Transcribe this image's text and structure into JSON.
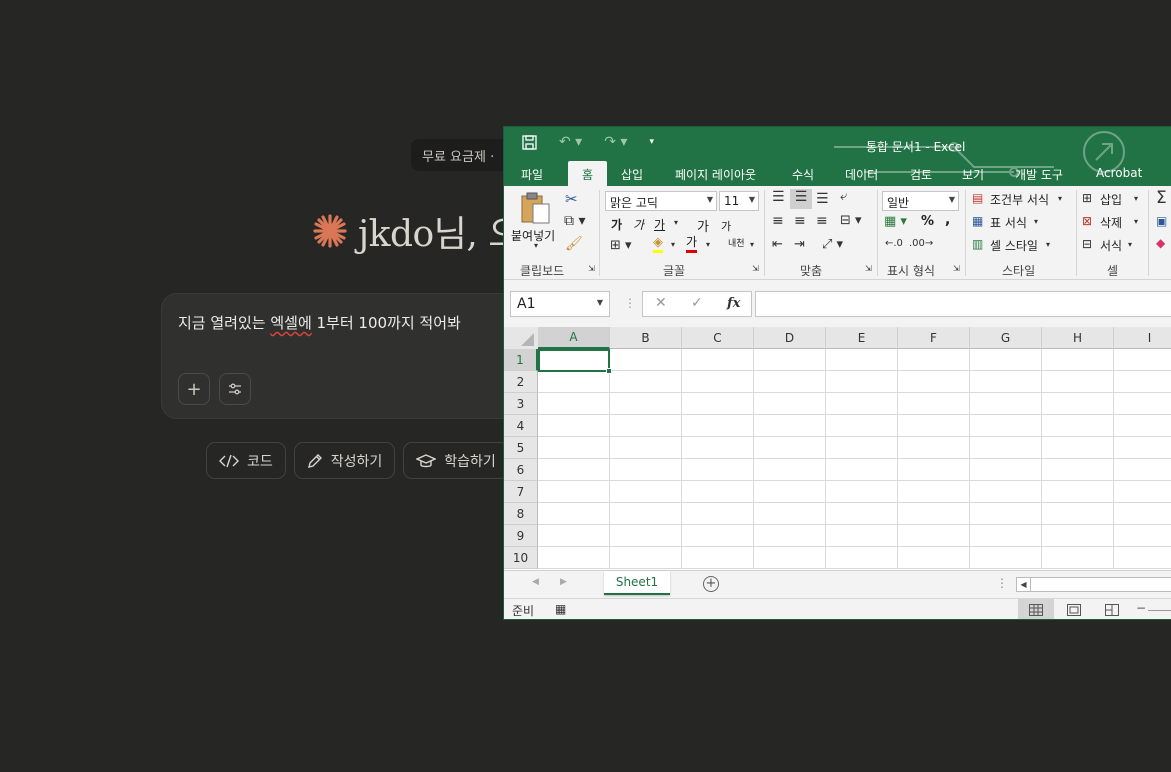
{
  "chat": {
    "plan_badge": "무료 요금제 ·",
    "greeting": "jkdo님, 오",
    "prompt_text_before": "지금 열려있는 ",
    "prompt_text_spell": "엑셀에",
    "prompt_text_after": "  1부터 100까지 적어봐",
    "plus_label": "+",
    "chips": [
      {
        "label": "코드",
        "icon": "code-icon"
      },
      {
        "label": "작성하기",
        "icon": "pencil-icon"
      },
      {
        "label": "학습하기",
        "icon": "graduation-cap-icon"
      }
    ],
    "accent": "#d97757"
  },
  "excel": {
    "title": "통합 문서1 - Excel",
    "tabs": [
      "파일",
      "홈",
      "삽입",
      "페이지 레이아웃",
      "수식",
      "데이터",
      "검토",
      "보기",
      "개발 도구",
      "Acrobat"
    ],
    "active_tab": "홈",
    "ribbon": {
      "clipboard": {
        "label": "클립보드",
        "paste": "붙여넣기"
      },
      "font": {
        "label": "글꼴",
        "font_name": "맑은 고딕",
        "font_size": "11",
        "bold": "가",
        "italic": "가",
        "underline": "가",
        "grow": "가",
        "shrink": "가",
        "font_color_glyph": "가",
        "phonetic": "내천"
      },
      "alignment": {
        "label": "맞춤"
      },
      "number": {
        "label": "표시 형식",
        "format": "일반",
        "percent": "%",
        "comma": ","
      },
      "styles": {
        "label": "스타일",
        "conditional": "조건부 서식",
        "table": "표 서식",
        "cell_styles": "셀 스타일"
      },
      "cells": {
        "label": "셀",
        "insert": "삽입",
        "delete": "삭제",
        "format": "서식"
      }
    },
    "name_box": "A1",
    "fx_label": "fx",
    "columns": [
      "A",
      "B",
      "C",
      "D",
      "E",
      "F",
      "G",
      "H",
      "I"
    ],
    "rows": [
      "1",
      "2",
      "3",
      "4",
      "5",
      "6",
      "7",
      "8",
      "9",
      "10"
    ],
    "sheet_tab": "Sheet1",
    "add_sheet": "+",
    "status": "준비",
    "brand_color": "#217346"
  }
}
